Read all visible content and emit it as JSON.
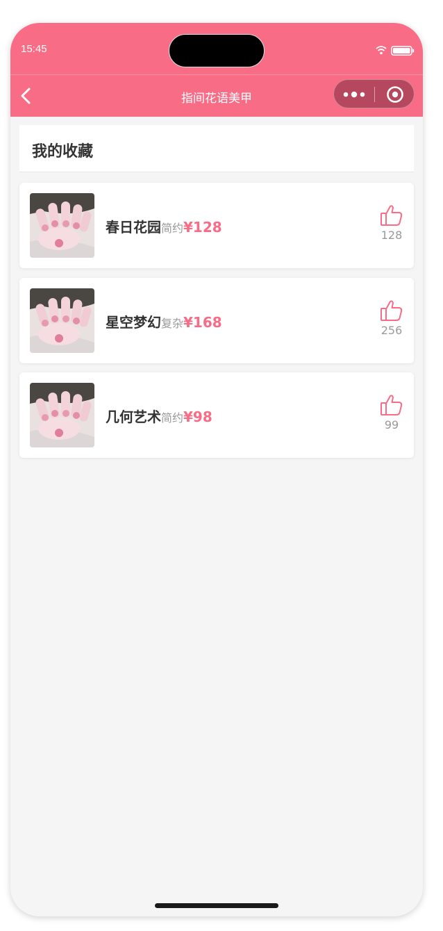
{
  "status_bar": {
    "time": "15:45"
  },
  "nav": {
    "title": "指间花语美甲",
    "back_icon": "chevron-left-icon",
    "more_icon": "more-dots-icon",
    "close_icon": "target-close-icon"
  },
  "section": {
    "title": "我的收藏"
  },
  "favorites": [
    {
      "name": "春日花园",
      "style": "简约",
      "price": "¥128",
      "likes": "128"
    },
    {
      "name": "星空梦幻",
      "style": "复杂",
      "price": "¥168",
      "likes": "256"
    },
    {
      "name": "几何艺术",
      "style": "简约",
      "price": "¥98",
      "likes": "99"
    }
  ],
  "colors": {
    "brand": "#f96c86",
    "capsule": "#b5485f",
    "background": "#f5f5f5",
    "text_primary": "#333333",
    "text_secondary": "#999999"
  }
}
